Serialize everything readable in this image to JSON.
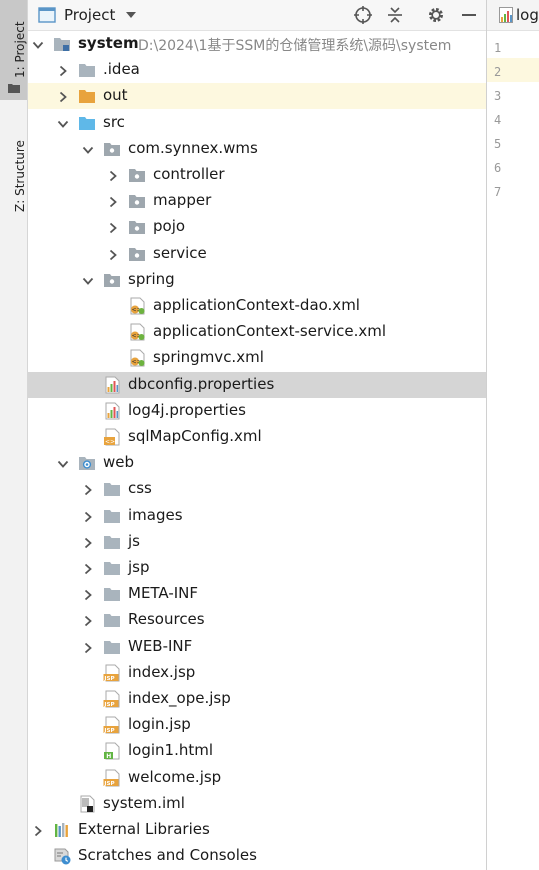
{
  "side_strip": {
    "project_tab": "1: Project",
    "structure_tab": "Z: Structure"
  },
  "project_panel": {
    "title": "Project",
    "tree": [
      {
        "label": "system",
        "path": "D:\\2024\\1基于SSM的仓储管理系统\\源码\\system",
        "level": 0,
        "arrow": "down",
        "icon": "module-folder",
        "bold": true
      },
      {
        "label": ".idea",
        "level": 1,
        "arrow": "right",
        "icon": "folder"
      },
      {
        "label": "out",
        "level": 1,
        "arrow": "right",
        "icon": "orange-folder"
      },
      {
        "label": "src",
        "level": 1,
        "arrow": "down",
        "icon": "source-folder"
      },
      {
        "label": "com.synnex.wms",
        "level": 2,
        "arrow": "down",
        "icon": "package"
      },
      {
        "label": "controller",
        "level": 3,
        "arrow": "right",
        "icon": "package"
      },
      {
        "label": "mapper",
        "level": 3,
        "arrow": "right",
        "icon": "package"
      },
      {
        "label": "pojo",
        "level": 3,
        "arrow": "right",
        "icon": "package"
      },
      {
        "label": "service",
        "level": 3,
        "arrow": "right",
        "icon": "package"
      },
      {
        "label": "spring",
        "level": 2,
        "arrow": "down",
        "icon": "package"
      },
      {
        "label": "applicationContext-dao.xml",
        "level": 3,
        "arrow": "none",
        "icon": "spring-xml"
      },
      {
        "label": "applicationContext-service.xml",
        "level": 3,
        "arrow": "none",
        "icon": "spring-xml"
      },
      {
        "label": "springmvc.xml",
        "level": 3,
        "arrow": "none",
        "icon": "spring-xml"
      },
      {
        "label": "dbconfig.properties",
        "level": 2,
        "arrow": "none",
        "icon": "properties",
        "selected": true
      },
      {
        "label": "log4j.properties",
        "level": 2,
        "arrow": "none",
        "icon": "properties"
      },
      {
        "label": "sqlMapConfig.xml",
        "level": 2,
        "arrow": "none",
        "icon": "xml"
      },
      {
        "label": "web",
        "level": 1,
        "arrow": "down",
        "icon": "web-folder"
      },
      {
        "label": "css",
        "level": 2,
        "arrow": "right",
        "icon": "folder"
      },
      {
        "label": "images",
        "level": 2,
        "arrow": "right",
        "icon": "folder"
      },
      {
        "label": "js",
        "level": 2,
        "arrow": "right",
        "icon": "folder"
      },
      {
        "label": "jsp",
        "level": 2,
        "arrow": "right",
        "icon": "folder"
      },
      {
        "label": "META-INF",
        "level": 2,
        "arrow": "right",
        "icon": "folder"
      },
      {
        "label": "Resources",
        "level": 2,
        "arrow": "right",
        "icon": "folder"
      },
      {
        "label": "WEB-INF",
        "level": 2,
        "arrow": "right",
        "icon": "folder"
      },
      {
        "label": "index.jsp",
        "level": 2,
        "arrow": "none",
        "icon": "jsp"
      },
      {
        "label": "index_ope.jsp",
        "level": 2,
        "arrow": "none",
        "icon": "jsp"
      },
      {
        "label": "login.jsp",
        "level": 2,
        "arrow": "none",
        "icon": "jsp"
      },
      {
        "label": "login1.html",
        "level": 2,
        "arrow": "none",
        "icon": "html"
      },
      {
        "label": "welcome.jsp",
        "level": 2,
        "arrow": "none",
        "icon": "jsp"
      },
      {
        "label": "system.iml",
        "level": 1,
        "arrow": "none",
        "icon": "iml"
      },
      {
        "label": "External Libraries",
        "level": 0,
        "arrow": "right",
        "icon": "libraries"
      },
      {
        "label": "Scratches and Consoles",
        "level": 0,
        "arrow": "none",
        "icon": "scratches"
      }
    ]
  },
  "editor": {
    "tab_label": "log",
    "line_numbers": [
      "1",
      "2",
      "3",
      "4",
      "5",
      "6",
      "7"
    ],
    "current_line": 2
  },
  "colors": {
    "selection": "#d5d5d5",
    "highlight_row": "#fdf8df",
    "folder": "#a9b4bd",
    "package": "#9ea7ae",
    "orange_folder": "#e8a33d",
    "source_folder": "#5fb8e8"
  }
}
